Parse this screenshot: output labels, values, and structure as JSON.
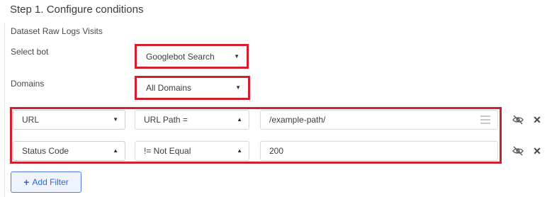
{
  "step": {
    "title": "Step 1. Configure conditions"
  },
  "dataset": {
    "label": "Dataset Raw Logs Visits"
  },
  "bot": {
    "label": "Select bot",
    "value": "Googlebot Search"
  },
  "domains": {
    "label": "Domains",
    "value": "All Domains"
  },
  "filters": [
    {
      "field": "URL",
      "operator": "URL Path =",
      "value": "/example-path/"
    },
    {
      "field": "Status Code",
      "operator": "!= Not Equal",
      "value": "200"
    }
  ],
  "icons": {
    "caret_down": "▼",
    "caret_up": "▲",
    "close": "✕"
  },
  "colors": {
    "highlight": "#d0202e",
    "accent": "#3566c7"
  },
  "actions": {
    "add_filter_label": "Add Filter",
    "add_filter_icon": "+"
  }
}
